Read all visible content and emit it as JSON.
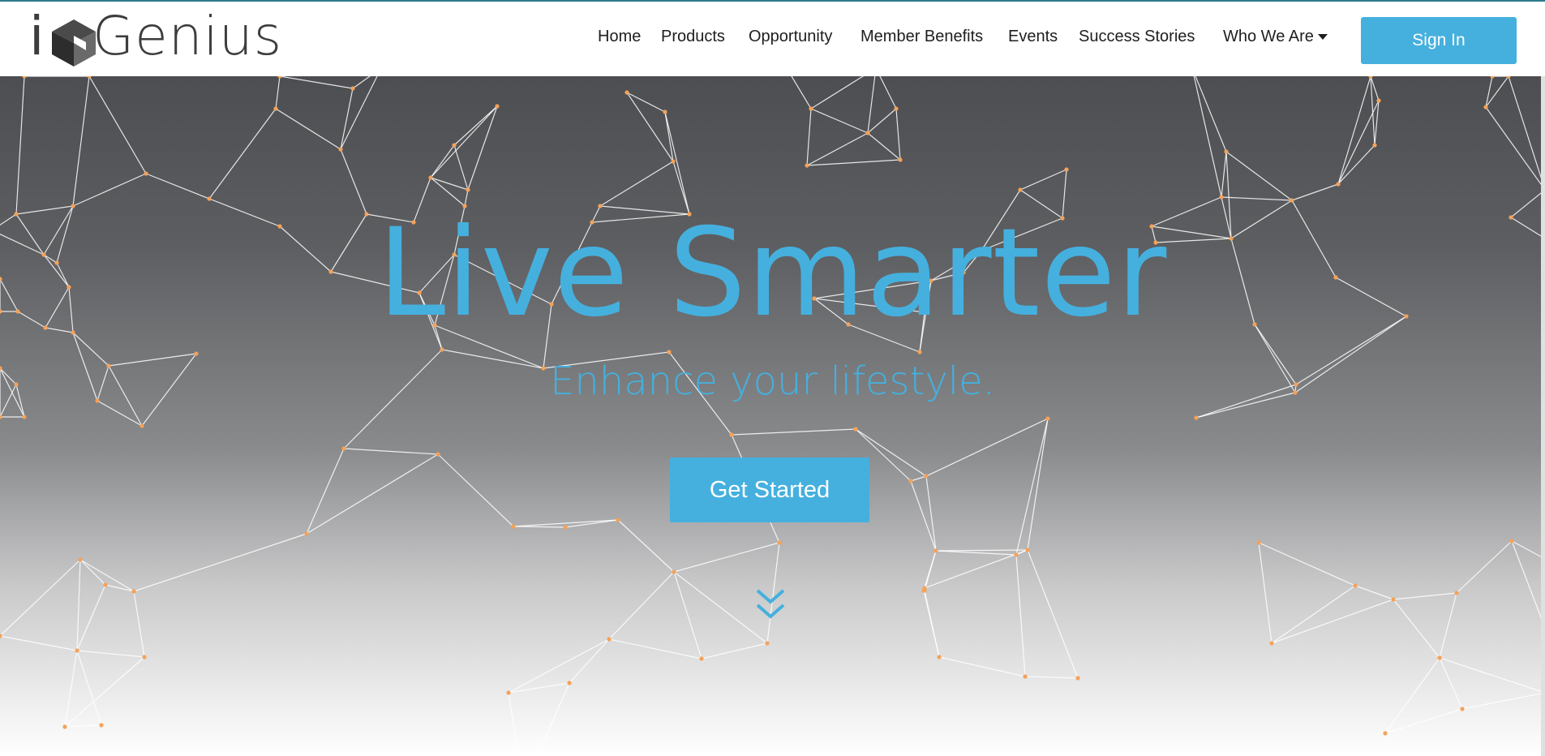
{
  "brand": {
    "logo_text": "Genius",
    "logo_prefix": "i",
    "text_color": "#3d3d3d",
    "mark_colors": [
      "#2d2d2d",
      "#4a4a4a",
      "#6a6a6a"
    ]
  },
  "nav": {
    "items": [
      {
        "label": "Home"
      },
      {
        "label": "Products"
      },
      {
        "label": "Opportunity"
      },
      {
        "label": "Member Benefits"
      },
      {
        "label": "Events"
      },
      {
        "label": "Success Stories"
      },
      {
        "label": "Who We Are",
        "has_dropdown": true
      }
    ],
    "dropdown_icon": "caret-down-icon",
    "signin_label": "Sign In"
  },
  "hero": {
    "headline": "Live Smarter",
    "subheadline": "Enhance your lifestyle.",
    "cta_label": "Get Started",
    "scroll_icon": "double-chevron-down-icon",
    "background_icon": "network-nodes-graphic"
  },
  "colors": {
    "accent": "#45b0de",
    "node": "#f4a259",
    "line": "#ffffff",
    "hero_top": "#4d4e51",
    "hero_bottom": "#ffffff"
  }
}
